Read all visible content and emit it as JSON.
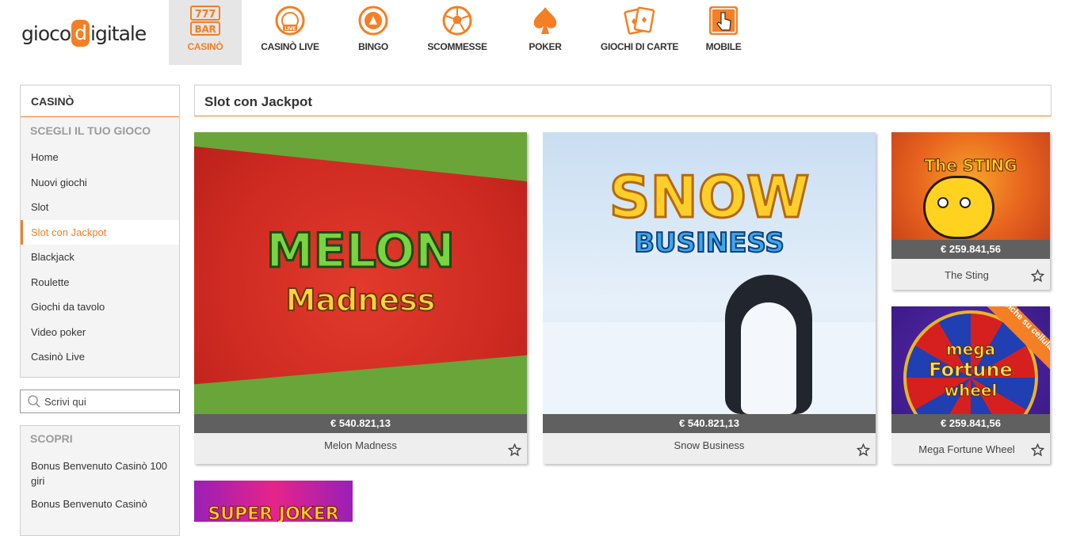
{
  "brand": {
    "left": "gioco",
    "d": "d",
    "right": "igitale",
    "accent": "#f47f24"
  },
  "nav": [
    {
      "label": "CASINÒ",
      "icon": "slot-machine-icon",
      "active": true
    },
    {
      "label": "CASINÒ LIVE",
      "icon": "live-chip-icon"
    },
    {
      "label": "BINGO",
      "icon": "bingo-ball-icon"
    },
    {
      "label": "SCOMMESSE",
      "icon": "soccer-ball-icon"
    },
    {
      "label": "POKER",
      "icon": "spade-icon"
    },
    {
      "label": "GIOCHI DI CARTE",
      "icon": "cards-icon"
    },
    {
      "label": "MOBILE",
      "icon": "touch-icon"
    }
  ],
  "sidebar": {
    "title": "CASINÒ",
    "section_title": "SCEGLI IL TUO GIOCO",
    "items": [
      {
        "label": "Home"
      },
      {
        "label": "Nuovi giochi"
      },
      {
        "label": "Slot"
      },
      {
        "label": "Slot con Jackpot",
        "active": true
      },
      {
        "label": "Blackjack"
      },
      {
        "label": "Roulette"
      },
      {
        "label": "Giochi da tavolo"
      },
      {
        "label": "Video poker"
      },
      {
        "label": "Casinò Live"
      }
    ]
  },
  "search": {
    "placeholder": "Scrivi qui"
  },
  "discover": {
    "title": "SCOPRI",
    "items": [
      {
        "label": "Bonus Benvenuto Casinò 100 giri"
      },
      {
        "label": "Bonus Benvenuto Casinò"
      }
    ]
  },
  "main": {
    "title": "Slot con Jackpot",
    "games": [
      {
        "name": "Melon Madness",
        "jackpot": "€ 540.821,13",
        "art_line1": "MELON",
        "art_line2": "Madness"
      },
      {
        "name": "Snow Business",
        "jackpot": "€ 540.821,13",
        "art_line1": "SNOW",
        "art_line2": "BUSINESS"
      },
      {
        "name": "The Sting",
        "jackpot": "€ 259.841,56",
        "art_line1": "The STING"
      },
      {
        "name": "Mega Fortune Wheel",
        "jackpot": "€ 259.841,56",
        "art_line1": "mega",
        "art_line2": "Fortune",
        "art_line3": "wheel",
        "ribbon": "Anche su cellulare"
      },
      {
        "art_line1": "SUPER JOKER"
      }
    ]
  }
}
